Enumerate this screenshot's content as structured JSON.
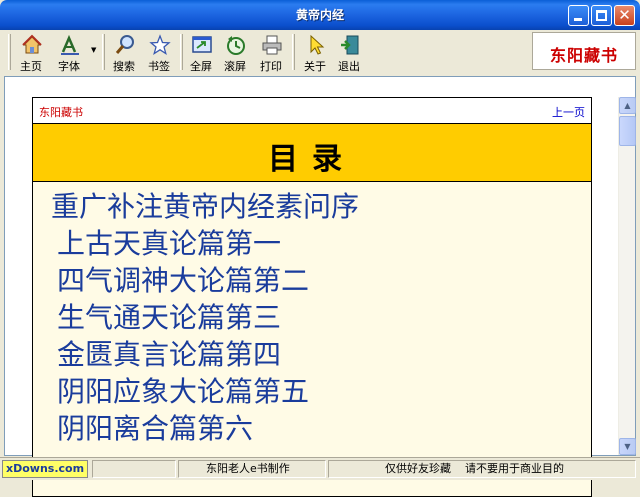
{
  "window": {
    "title": "黄帝内经"
  },
  "toolbar": {
    "buttons": [
      {
        "label": "主页",
        "icon": "home-icon"
      },
      {
        "label": "字体",
        "icon": "font-icon"
      },
      {
        "label": "搜索",
        "icon": "search-icon"
      },
      {
        "label": "书签",
        "icon": "bookmark-icon"
      },
      {
        "label": "全屏",
        "icon": "fullscreen-icon"
      },
      {
        "label": "滚屏",
        "icon": "autoscroll-icon"
      },
      {
        "label": "打印",
        "icon": "print-icon"
      },
      {
        "label": "关于",
        "icon": "about-icon"
      },
      {
        "label": "退出",
        "icon": "exit-icon"
      }
    ],
    "logo_text": "东阳藏书"
  },
  "page": {
    "brand_link": "东阳藏书",
    "prev_link": "上一页",
    "heading": "目录",
    "toc": [
      "重广补注黄帝内经素问序",
      "上古天真论篇第一",
      "四气调神大论篇第二",
      "生气通天论篇第三",
      "金匮真言论篇第四",
      "阴阳应象大论篇第五",
      "阴阳离合篇第六"
    ]
  },
  "statusbar": {
    "watermark": "xDowns.com",
    "credit": "东阳老人e书制作",
    "notice": "仅供好友珍藏    请不要用于商业目的"
  },
  "colors": {
    "accent": "#ffcc00",
    "link": "#1a3c9c",
    "brand": "#cc0000"
  }
}
